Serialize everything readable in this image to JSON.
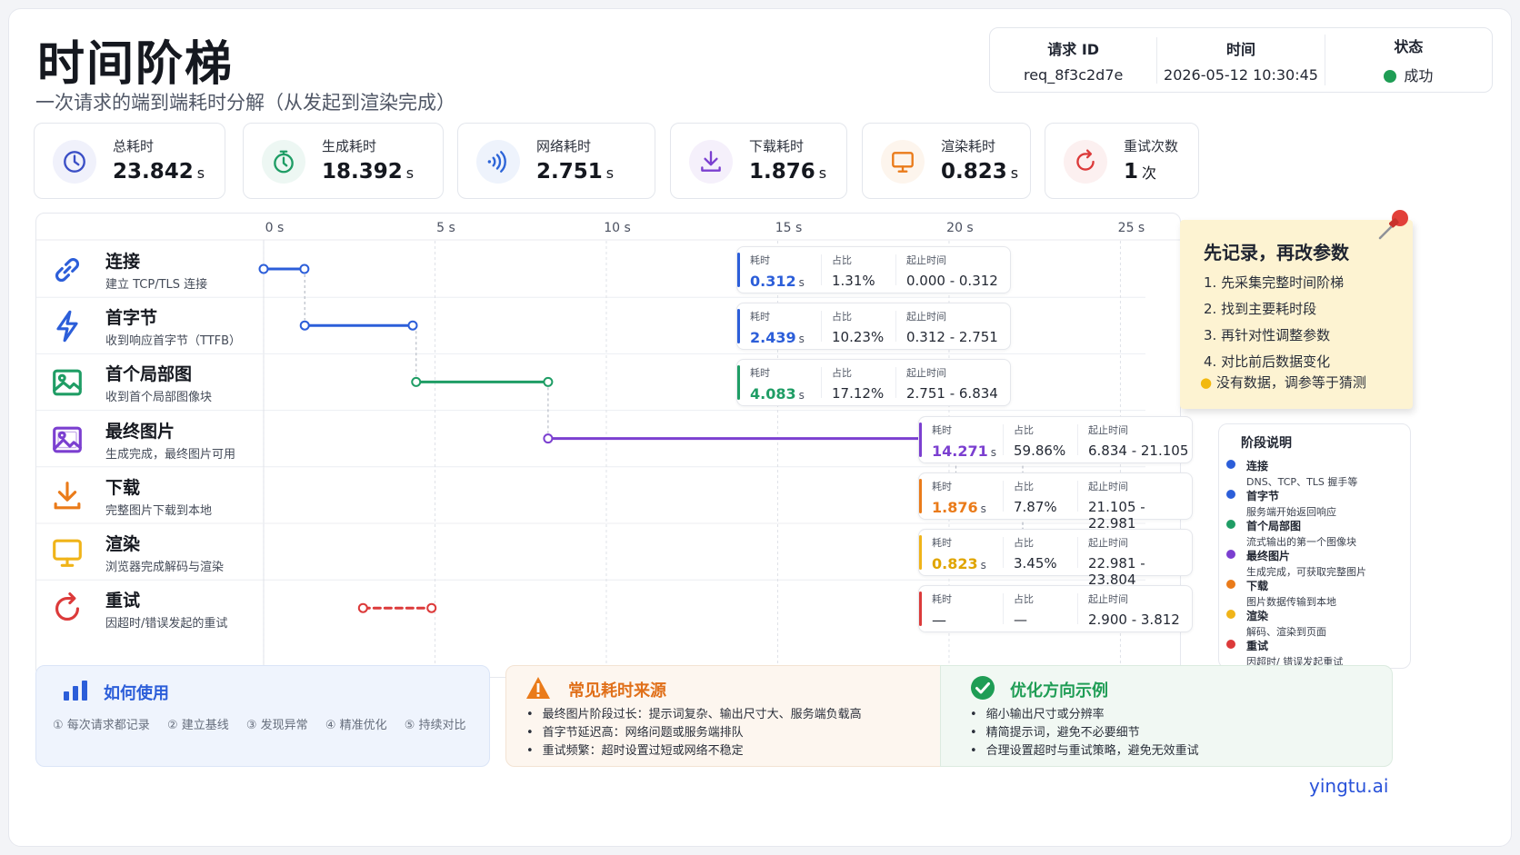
{
  "header": {
    "title": "时间阶梯",
    "subtitle": "一次请求的端到端耗时分解（从发起到渲染完成）"
  },
  "meta": {
    "request_id_label": "请求 ID",
    "request_id": "req_8f3c2d7e",
    "time_label": "时间",
    "time": "2026-05-12 10:30:45",
    "status_label": "状态",
    "status": "成功",
    "status_color": "#1f9d55"
  },
  "kpis": [
    {
      "label": "总耗时",
      "value": "23.842",
      "unit": "s",
      "icon": "clock-icon",
      "color": "#3b4fc6"
    },
    {
      "label": "生成耗时",
      "value": "18.392",
      "unit": "s",
      "icon": "stopwatch-icon",
      "color": "#1f9d65"
    },
    {
      "label": "网络耗时",
      "value": "2.751",
      "unit": "s",
      "icon": "wifi-signal-icon",
      "color": "#2c64d8"
    },
    {
      "label": "下载耗时",
      "value": "1.876",
      "unit": "s",
      "icon": "download-icon",
      "color": "#7b3fd0"
    },
    {
      "label": "渲染耗时",
      "value": "0.823",
      "unit": "s",
      "icon": "monitor-icon",
      "color": "#ea7b1a"
    },
    {
      "label": "重试次数",
      "value": "1",
      "unit": "次",
      "icon": "retry-icon",
      "color": "#dc3a3a"
    }
  ],
  "chart_data": {
    "type": "gantt",
    "xlim": [
      0,
      26.5
    ],
    "x_ticks": [
      0,
      5,
      10,
      15,
      20,
      25
    ],
    "x_tick_labels": [
      "0 s",
      "5 s",
      "10 s",
      "15 s",
      "20 s",
      "25 s"
    ],
    "stat_headers": {
      "duration": "耗时",
      "share": "占比",
      "range": "起止时间"
    },
    "stages": [
      {
        "name": "连接",
        "desc": "建立 TCP/TLS 连接",
        "start": 0.0,
        "end": 1.19,
        "color": "#2c5ed9",
        "icon": "link-icon",
        "duration": "0.312",
        "duration_unit": "s",
        "share": "1.31%",
        "range": "0.000 - 0.312"
      },
      {
        "name": "首字节",
        "desc": "收到响应首字节（TTFB）",
        "start": 1.2,
        "end": 4.35,
        "color": "#2c5ed9",
        "icon": "lightning-icon",
        "duration": "2.439",
        "duration_unit": "s",
        "share": "10.23%",
        "range": "0.312 - 2.751"
      },
      {
        "name": "首个局部图",
        "desc": "收到首个局部图像块",
        "start": 4.45,
        "end": 8.3,
        "color": "#1f9d65",
        "icon": "image-icon",
        "duration": "4.083",
        "duration_unit": "s",
        "share": "17.12%",
        "range": "2.751 - 6.834"
      },
      {
        "name": "最终图片",
        "desc": "生成完成，最终图片可用",
        "start": 8.3,
        "end": 20.2,
        "extend_to": 22.15,
        "color": "#7b3fd0",
        "icon": "image-gallery-icon",
        "duration": "14.271",
        "duration_unit": "s",
        "share": "59.86%",
        "range": "6.834 - 21.105"
      },
      {
        "name": "下载",
        "desc": "完整图片下载到本地",
        "start": 20.2,
        "end": 22.15,
        "color": "#ea7b1a",
        "icon": "download-icon",
        "duration": "1.876",
        "duration_unit": "s",
        "share": "7.87%",
        "range": "21.105 - 22.981"
      },
      {
        "name": "渲染",
        "desc": "浏览器完成解码与渲染",
        "start": 22.15,
        "end": 22.9,
        "color": "#f0b419",
        "icon": "monitor-icon",
        "duration": "0.823",
        "duration_unit": "s",
        "share": "3.45%",
        "range": "22.981 - 23.804"
      },
      {
        "name": "重试",
        "desc": "因超时/错误发起的重试",
        "start": 2.9,
        "end": 4.9,
        "dashed": true,
        "color": "#dc3a3a",
        "icon": "retry-icon",
        "duration": "—",
        "duration_unit": "",
        "share": "—",
        "range": "2.900 - 3.812"
      }
    ]
  },
  "note": {
    "title": "先记录，再改参数",
    "items": [
      "1. 先采集完整时间阶梯",
      "2. 找到主要耗时段",
      "3. 再针对性调整参数",
      "4. 对比前后数据变化"
    ],
    "tip": "没有数据，调参等于猜测",
    "pin_icon": "pushpin-icon",
    "tip_icon": "lightbulb-icon"
  },
  "legend": {
    "title": "阶段说明",
    "items": [
      {
        "name": "连接",
        "desc": "DNS、TCP、TLS 握手等",
        "color": "#2c5ed9"
      },
      {
        "name": "首字节",
        "desc": "服务端开始返回响应",
        "color": "#2c5ed9"
      },
      {
        "name": "首个局部图",
        "desc": "流式输出的第一个图像块",
        "color": "#1f9d65"
      },
      {
        "name": "最终图片",
        "desc": "生成完成，可获取完整图片",
        "color": "#7b3fd0"
      },
      {
        "name": "下载",
        "desc": "图片数据传输到本地",
        "color": "#ea7b1a"
      },
      {
        "name": "渲染",
        "desc": "解码、渲染到页面",
        "color": "#f0b419"
      },
      {
        "name": "重试",
        "desc": "因超时/ 错误发起重试",
        "color": "#dc3a3a"
      }
    ]
  },
  "howto": {
    "title": "如何使用",
    "steps": [
      "① 每次请求都记录",
      "② 建立基线",
      "③ 发现异常",
      "④ 精准优化",
      "⑤ 持续对比"
    ]
  },
  "sources": {
    "title": "常见耗时来源",
    "items": [
      "最终图片阶段过长：提示词复杂、输出尺寸大、服务端负载高",
      "首字节延迟高：网络问题或服务端排队",
      "重试频繁：超时设置过短或网络不稳定"
    ]
  },
  "optimize": {
    "title": "优化方向示例",
    "items": [
      "缩小输出尺寸或分辨率",
      "精简提示词，避免不必要细节",
      "合理设置超时与重试策略，避免无效重试"
    ]
  },
  "brand": "yingtu.ai"
}
